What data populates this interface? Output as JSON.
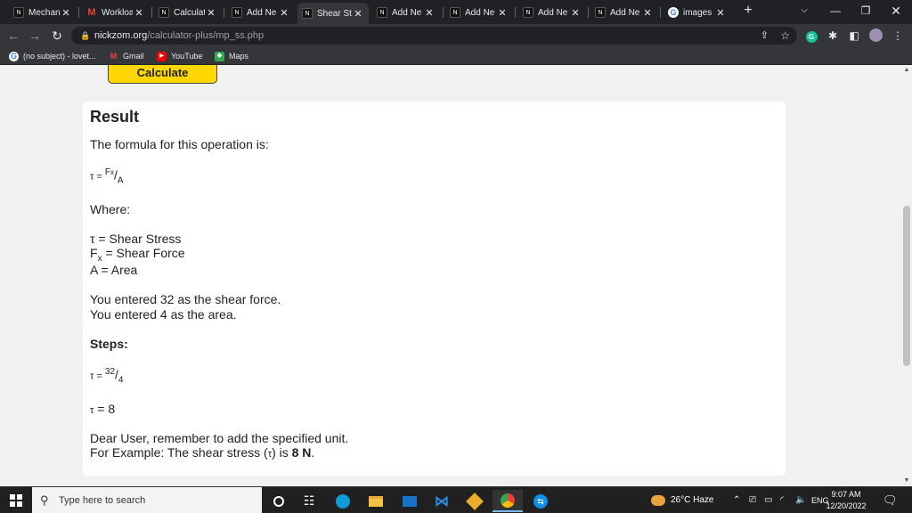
{
  "tabs": [
    {
      "label": "Mechan",
      "icon": "nickzom-icon",
      "active": false
    },
    {
      "label": "Workloa",
      "icon": "gmail-icon",
      "active": false
    },
    {
      "label": "Calculat",
      "icon": "nickzom-icon",
      "active": false
    },
    {
      "label": "Add Ne",
      "icon": "nickzom-icon",
      "active": false
    },
    {
      "label": "Shear St",
      "icon": "nickzom-icon",
      "active": true
    },
    {
      "label": "Add Ne",
      "icon": "nickzom-icon",
      "active": false
    },
    {
      "label": "Add Ne",
      "icon": "nickzom-icon",
      "active": false
    },
    {
      "label": "Add Ne",
      "icon": "nickzom-icon",
      "active": false
    },
    {
      "label": "Add Ne",
      "icon": "nickzom-icon",
      "active": false
    },
    {
      "label": "images",
      "icon": "google-icon",
      "active": false
    }
  ],
  "address": {
    "host": "nickzom.org",
    "path": "/calculator-plus/mp_ss.php"
  },
  "bookmarks": [
    {
      "label": "(no subject) - lovet...",
      "icon": "google-icon"
    },
    {
      "label": "Gmail",
      "icon": "gmail-icon"
    },
    {
      "label": "YouTube",
      "icon": "youtube-icon"
    },
    {
      "label": "Maps",
      "icon": "maps-icon"
    }
  ],
  "page": {
    "calculate_button": "Calculate",
    "result_title": "Result",
    "formula_intro": "The formula for this operation is:",
    "tau": "τ",
    "eq": " = ",
    "fx": "F",
    "fx_sub": "x",
    "slash": "/",
    "area_sym": "A",
    "where": "Where:",
    "def_tau": "τ = Shear Stress",
    "def_fx_pre": "F",
    "def_fx_sub": "x",
    "def_fx_post": " = Shear Force",
    "def_a": "A = Area",
    "entered_force": "You entered 32 as the shear force.",
    "entered_area": "You entered 4 as the area.",
    "steps": "Steps:",
    "step_num": "32",
    "step_den": "4",
    "result_line": " = 8",
    "note1": "Dear User, remember to add the specified unit.",
    "note2_pre": "For Example: The shear stress (",
    "note2_mid": "τ",
    "note2_post": ") is ",
    "note2_val": "8 N",
    "note2_end": "."
  },
  "taskbar": {
    "search_placeholder": "Type here to search",
    "weather": "26°C  Haze",
    "lang": "ENG",
    "time": "9:07 AM",
    "date": "12/20/2022"
  }
}
